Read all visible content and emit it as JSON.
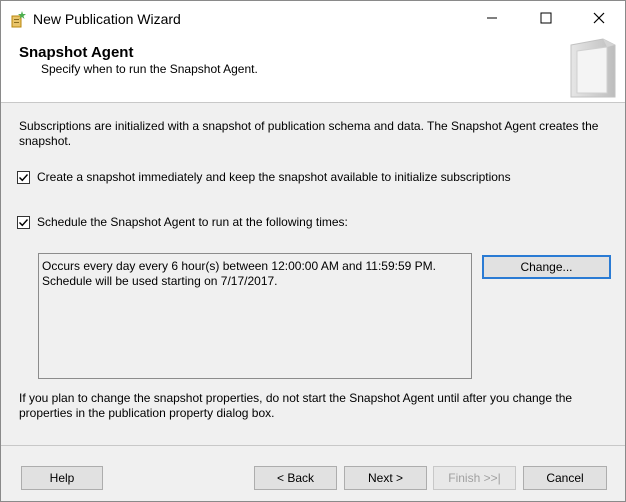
{
  "window": {
    "title": "New Publication Wizard"
  },
  "header": {
    "title": "Snapshot Agent",
    "subtitle": "Specify when to run the Snapshot Agent."
  },
  "body": {
    "intro": "Subscriptions are initialized with a snapshot of publication schema and data. The Snapshot Agent creates the snapshot.",
    "checkbox_create": {
      "label": "Create a snapshot immediately and keep the snapshot available to initialize subscriptions",
      "checked": true
    },
    "checkbox_schedule": {
      "label": "Schedule the Snapshot Agent to run at the following times:",
      "checked": true
    },
    "schedule_line1": "Occurs every day every 6 hour(s) between 12:00:00 AM and 11:59:59 PM.",
    "schedule_line2": "Schedule will be used starting on 7/17/2017.",
    "change_label": "Change...",
    "note": "If you plan to change the snapshot properties, do not start the Snapshot Agent until after you change the properties in the publication property dialog box."
  },
  "footer": {
    "help": "Help",
    "back": "< Back",
    "next": "Next >",
    "finish": "Finish >>|",
    "cancel": "Cancel"
  },
  "icons": {
    "app": "wizard-app-icon",
    "minimize": "minimize-icon",
    "maximize": "maximize-icon",
    "close": "close-icon",
    "header_art": "wizard-banner-art",
    "check": "checkmark-icon"
  },
  "colors": {
    "focus_border": "#2a7bd4",
    "disabled_text": "#a0a0a0"
  }
}
